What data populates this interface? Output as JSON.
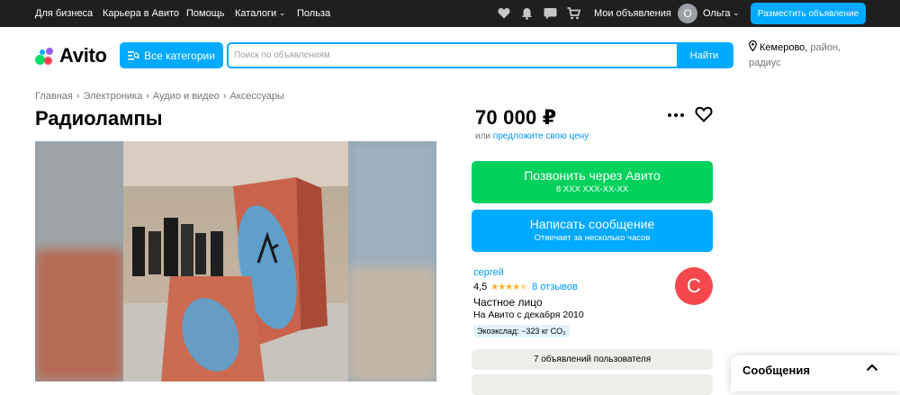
{
  "topbar": {
    "links": [
      "Для бизнеса",
      "Карьера в Авито",
      "Помощь",
      "Каталоги",
      "Польза"
    ],
    "my_ads": "Мои объявления",
    "user_initial": "О",
    "user_name": "Ольга",
    "post_button": "Разместить объявление",
    "icons": [
      "heart-icon",
      "bell-icon",
      "chat-icon",
      "cart-icon"
    ]
  },
  "header": {
    "logo": "Avito",
    "categories_button": "Все категории",
    "search_placeholder": "Поиск по объявлениям",
    "search_button": "Найти",
    "location_city": "Кемерово,",
    "location_rest": " район, радиус"
  },
  "breadcrumb": [
    "Главная",
    "Электроника",
    "Аудио и видео",
    "Аксессуары"
  ],
  "listing": {
    "title": "Радиолампы",
    "price": "70 000 ₽",
    "price_or": "или ",
    "price_offer_link": "предложите свою цену"
  },
  "actions": {
    "call_main": "Позвонить через Авито",
    "call_sub": "8 XXX XXX-XX-XX",
    "message_main": "Написать сообщение",
    "message_sub": "Отвечает за несколько часов"
  },
  "seller": {
    "name": "сергей",
    "rating": "4,5",
    "stars": 4.5,
    "reviews": "8 отзывов",
    "type": "Частное лицо",
    "since": "На Авито с декабря 2010",
    "eco": "Экоэкслад: −323 кг CO₂",
    "avatar_letter": "С",
    "avatar_color": "#f5484c",
    "listings": "7 объявлений пользователя"
  },
  "messages_popup": {
    "label": "Сообщения"
  },
  "colors": {
    "accent": "#00aaff",
    "call_green": "#02d15c",
    "link": "#0099f7",
    "topbar": "#1f1f1f"
  }
}
